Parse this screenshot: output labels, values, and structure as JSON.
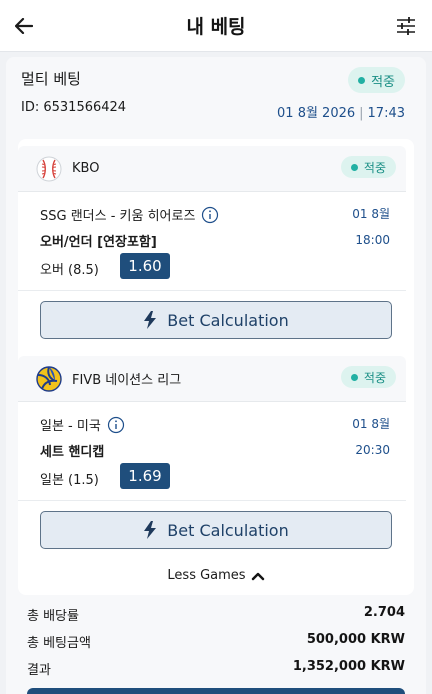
{
  "header": {
    "title": "내 베팅"
  },
  "bet": {
    "title": "멀티 베팅",
    "status": "적중",
    "id_text": "ID: 6531566424",
    "date": "01 8월 2026",
    "time": "17:43"
  },
  "games": [
    {
      "league": "KBO",
      "status": "적중",
      "teams": "SSG 랜더스 - 키움 히어로즈",
      "date": "01 8월",
      "market": "오버/언더 [연장포함]",
      "time": "18:00",
      "selection": "오버 (8.5)",
      "odds": "1.60",
      "calc_label": "Bet Calculation"
    },
    {
      "league": "FIVB 네이션스 리그",
      "status": "적중",
      "teams": "일본 - 미국",
      "date": "01 8월",
      "market": "세트 핸디캡",
      "time": "20:30",
      "selection": "일본 (1.5)",
      "odds": "1.69",
      "calc_label": "Bet Calculation"
    }
  ],
  "less_games_label": "Less Games",
  "summary": {
    "odds_label": "총 배당률",
    "odds_value": "2.704",
    "stake_label": "총 베팅금액",
    "stake_value": "500,000 KRW",
    "result_label": "결과",
    "result_value": "1,352,000 KRW"
  },
  "colors": {
    "accent": "#1f4e7c",
    "success": "#21b0a3",
    "date_blue": "#1e4f8b"
  }
}
